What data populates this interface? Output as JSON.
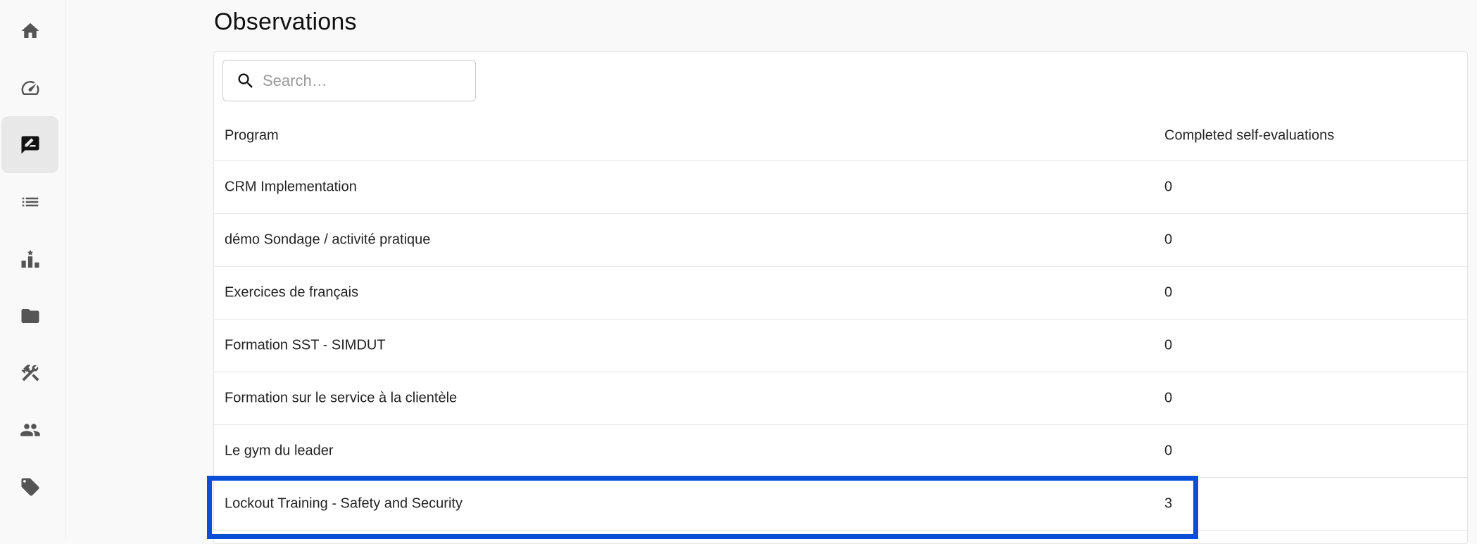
{
  "page": {
    "title": "Observations"
  },
  "nav": {
    "items": [
      {
        "name": "home",
        "icon": "home-icon",
        "active": false
      },
      {
        "name": "dashboard",
        "icon": "speedometer-icon",
        "active": false
      },
      {
        "name": "observations",
        "icon": "rate-review-icon",
        "active": true
      },
      {
        "name": "list",
        "icon": "list-icon",
        "active": false
      },
      {
        "name": "leaderboard",
        "icon": "leaderboard-icon",
        "active": false
      },
      {
        "name": "folder",
        "icon": "folder-icon",
        "active": false
      },
      {
        "name": "tools",
        "icon": "tools-icon",
        "active": false
      },
      {
        "name": "people",
        "icon": "people-icon",
        "active": false
      },
      {
        "name": "tags",
        "icon": "tag-icon",
        "active": false
      }
    ]
  },
  "search": {
    "placeholder": "Search…",
    "value": ""
  },
  "table": {
    "columns": [
      "Program",
      "Completed self-evaluations"
    ],
    "rows": [
      {
        "program": "CRM Implementation",
        "count": "0"
      },
      {
        "program": "démo Sondage / activité pratique",
        "count": "0"
      },
      {
        "program": "Exercices de français",
        "count": "0"
      },
      {
        "program": "Formation SST - SIMDUT",
        "count": "0"
      },
      {
        "program": "Formation sur le service à la clientèle",
        "count": "0"
      },
      {
        "program": "Le gym du leader",
        "count": "0"
      },
      {
        "program": "Lockout Training - Safety and Security",
        "count": "3"
      }
    ]
  },
  "colors": {
    "highlight": "#0a4fd8",
    "active_nav": "#e8e8e8"
  }
}
